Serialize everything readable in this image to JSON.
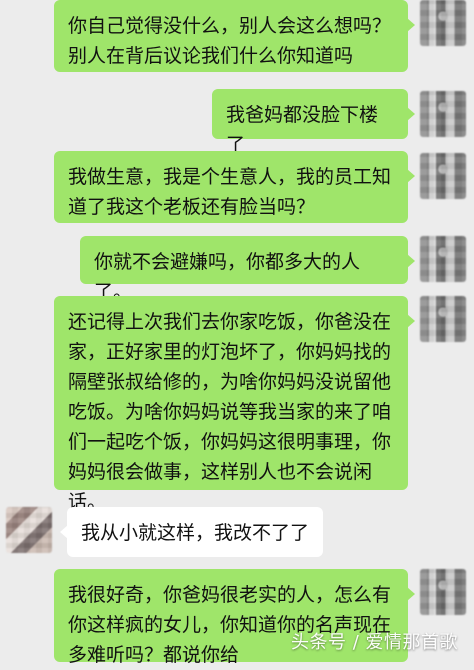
{
  "messages": [
    {
      "side": "right",
      "text": "你自己觉得没什么，别人会这么想吗？\n别人在背后议论我们什么你知道吗"
    },
    {
      "side": "right",
      "text": "我爸妈都没脸下楼了"
    },
    {
      "side": "right",
      "text": "我做生意，我是个生意人，我的员工知\n道了我这个老板还有脸当吗？"
    },
    {
      "side": "right",
      "text": "你就不会避嫌吗，你都多大的人了。"
    },
    {
      "side": "right",
      "text": "还记得上次我们去你家吃饭，你爸没在\n家，正好家里的灯泡坏了，你妈妈找的\n隔壁张叔给修的，为啥你妈妈没说留他\n吃饭。为啥你妈妈说等我当家的来了咱\n们一起吃个饭，你妈妈这很明事理，你\n妈妈很会做事，这样别人也不会说闲\n话。"
    },
    {
      "side": "left",
      "text": "我从小就这样，我改不了了"
    },
    {
      "side": "right",
      "text": "我很好奇，你爸妈很老实的人，怎么有\n你这样疯的女儿，你知道你的名声现在\n多难听吗？都说你给"
    }
  ],
  "watermark": "头条号 / 爱情那首歌"
}
